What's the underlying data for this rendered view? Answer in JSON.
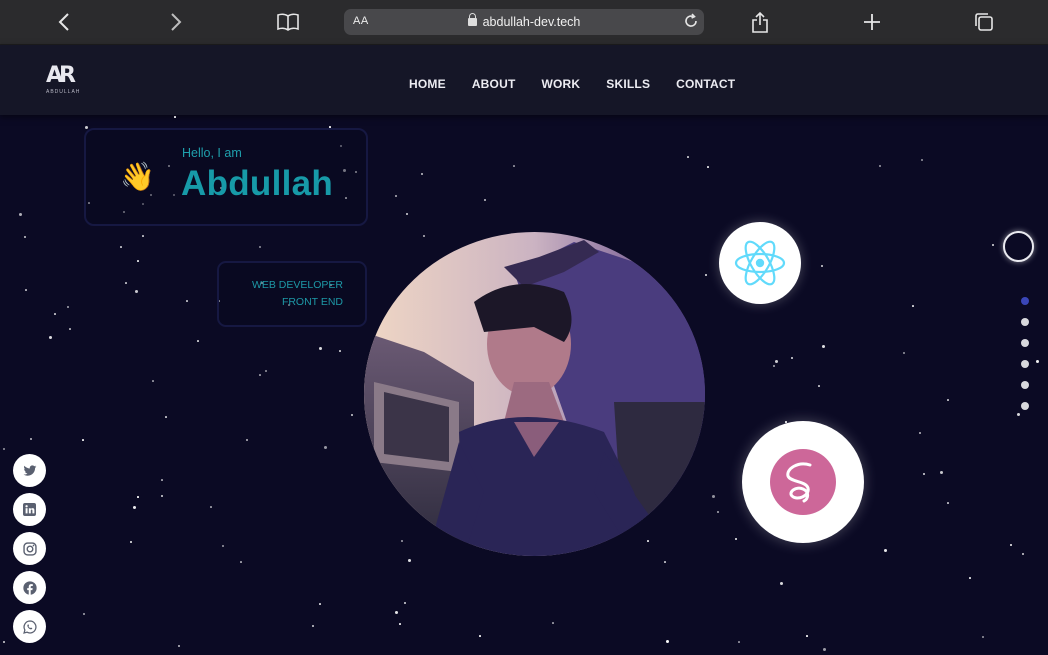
{
  "browser": {
    "url_prefix": "AA",
    "url": "abdullah-dev.tech",
    "icons": [
      "back-icon",
      "forward-icon",
      "reader-icon",
      "reload-icon",
      "share-icon",
      "new-tab-icon",
      "tabs-icon"
    ]
  },
  "nav": {
    "logo_mark": "AR",
    "logo_sub": "ABDULLAH",
    "links": [
      "HOME",
      "ABOUT",
      "WORK",
      "SKILLS",
      "CONTACT"
    ]
  },
  "hero": {
    "greeting": "Hello, I am",
    "name": "Abdullah",
    "wave_emoji": "👋",
    "role_line1": "WEB DEVELOPER",
    "role_line2": "FRONT END",
    "tech_icons": [
      "react-icon",
      "sass-icon"
    ]
  },
  "section_dots": {
    "count": 6,
    "active_index": 0
  },
  "socials": [
    "twitter-icon",
    "linkedin-icon",
    "instagram-icon",
    "facebook-icon",
    "whatsapp-icon"
  ],
  "colors": {
    "background": "#0b0a24",
    "accent_teal": "#179aa8",
    "nav_bg": "#151627",
    "dot_active": "#3a46b8",
    "react": "#61dafb",
    "sass": "#cd6799"
  }
}
